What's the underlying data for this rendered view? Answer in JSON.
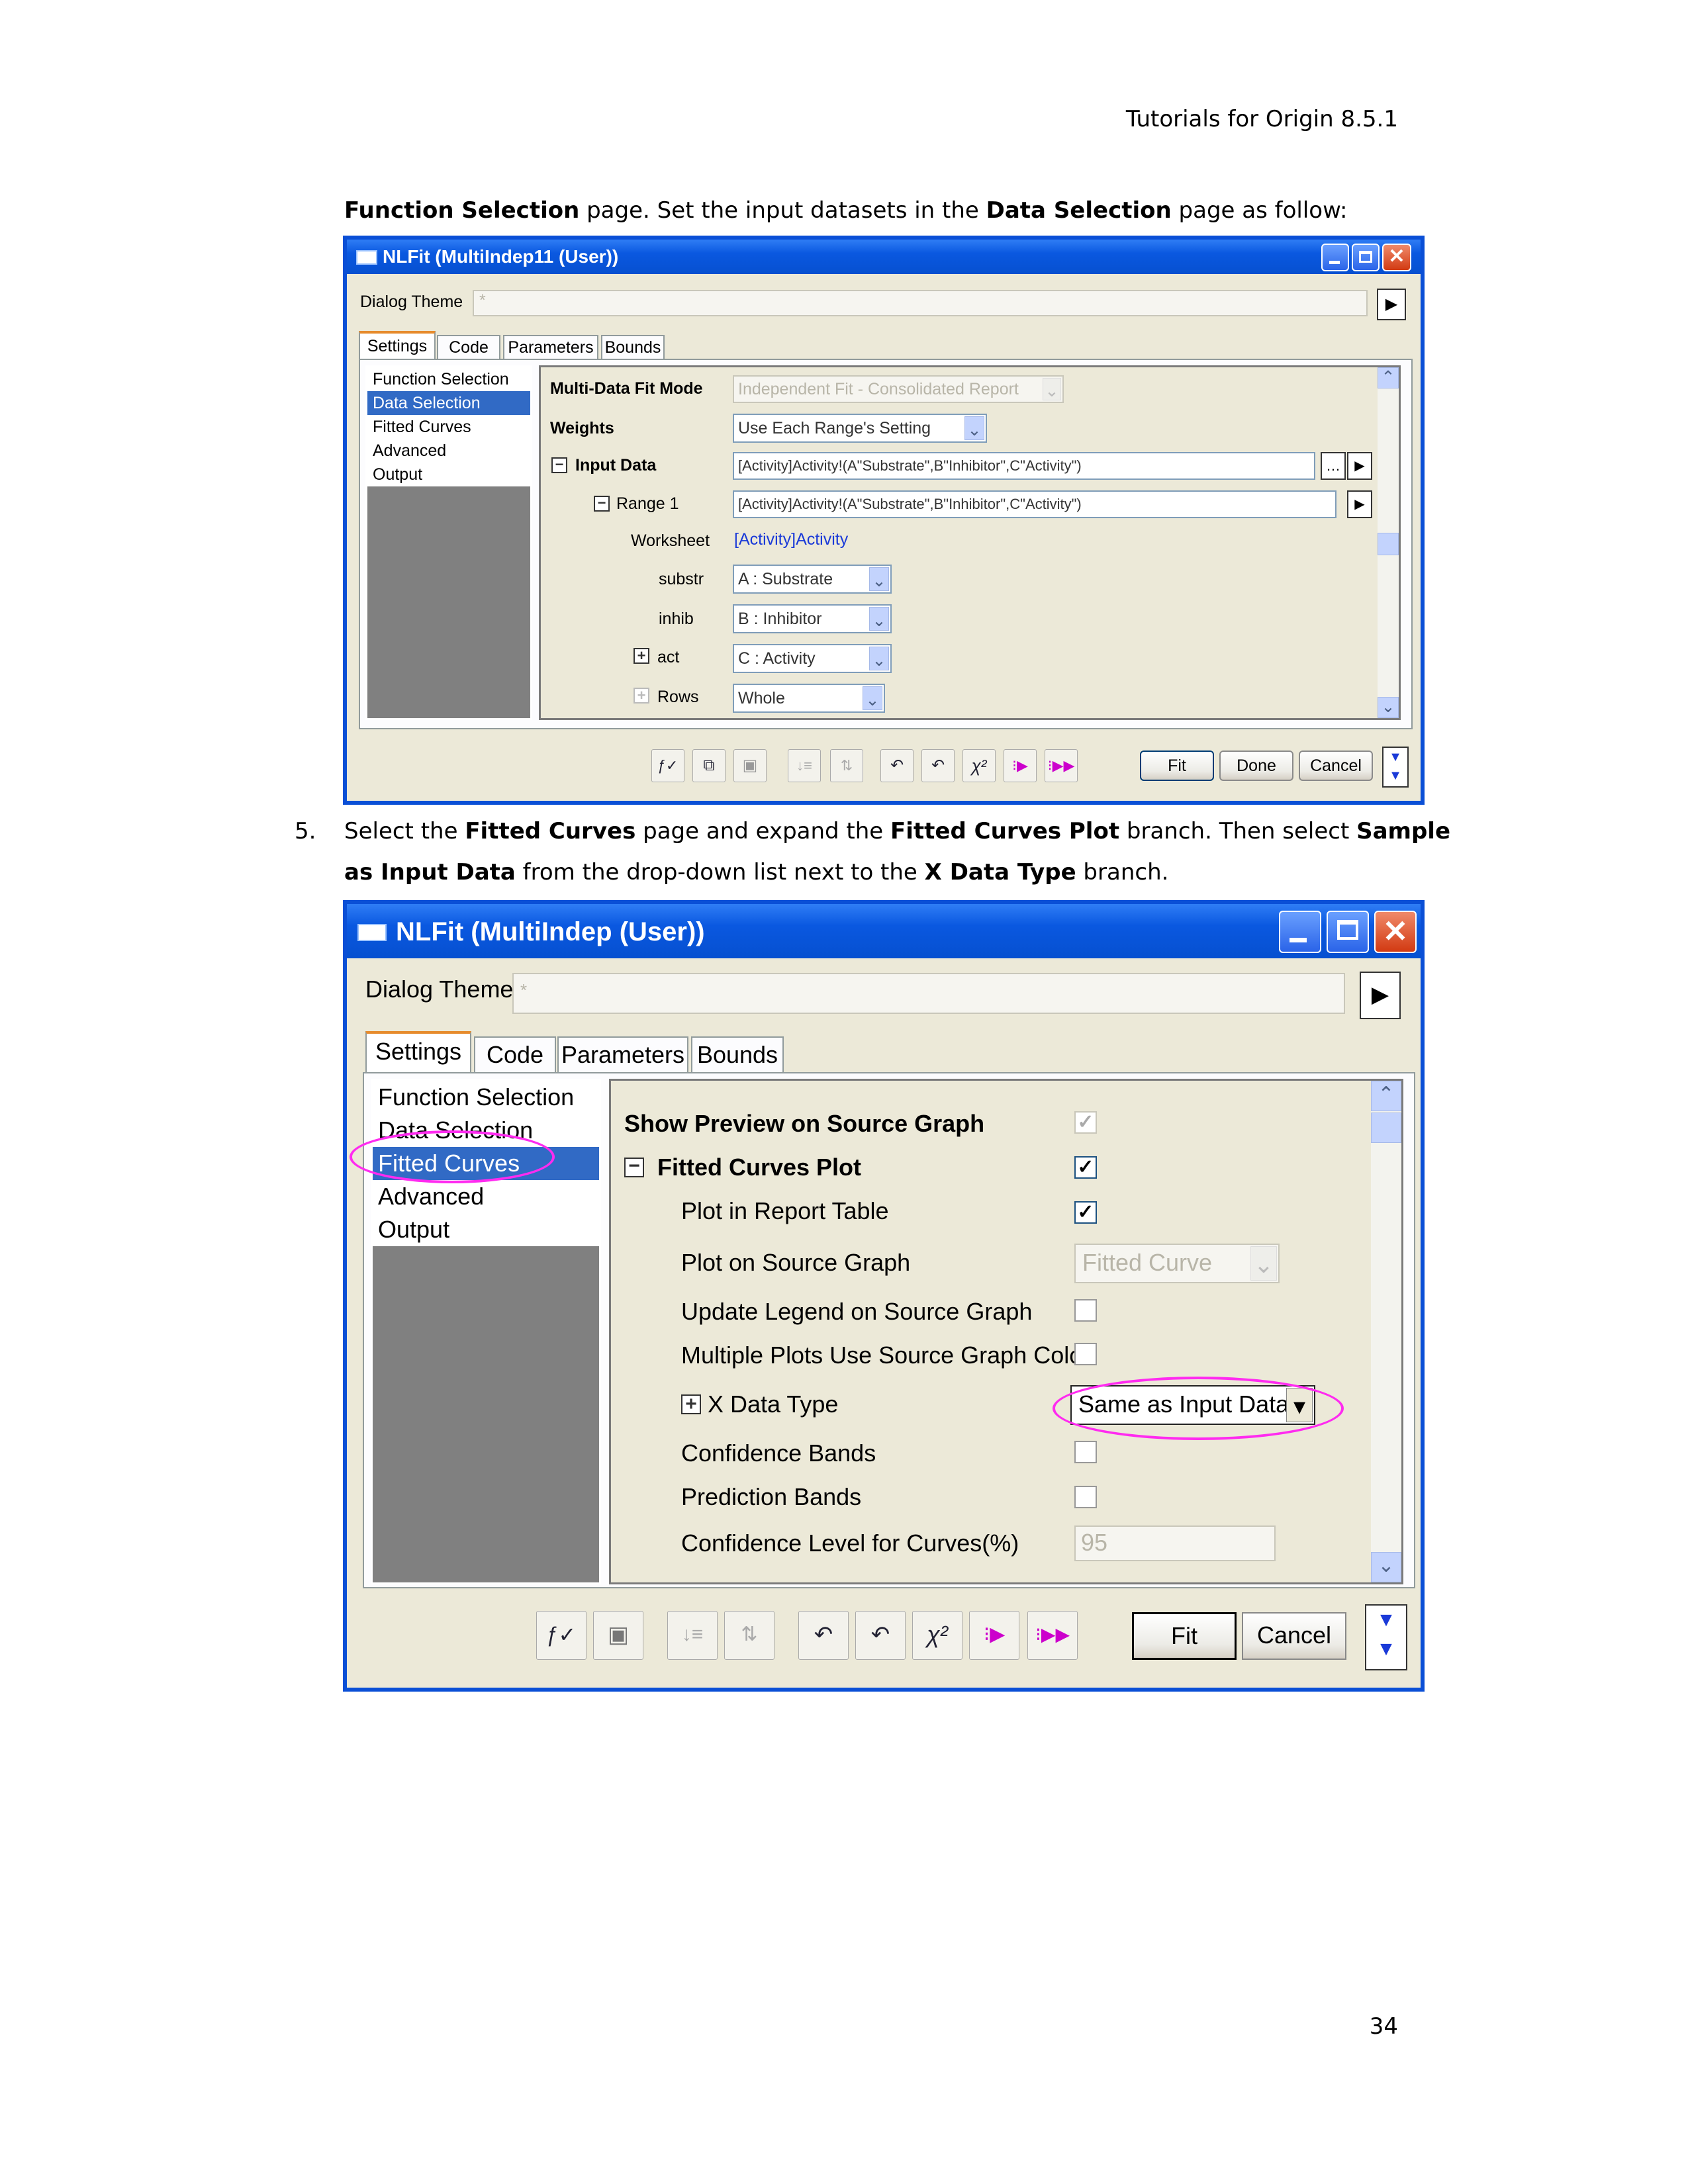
{
  "page": {
    "header": "Tutorials for Origin 8.5.1",
    "page_number": "34",
    "intro": {
      "b1": "Function Selection",
      "t1": " page. Set the input datasets in the ",
      "b2": "Data Selection",
      "t2": " page as follow:"
    },
    "step5": {
      "number": "5.",
      "t1": "Select the ",
      "b1": "Fitted Curves",
      "t2": " page and expand the ",
      "b2": "Fitted Curves Plot",
      "t3": " branch. Then select ",
      "b3": "Sample",
      "b4": "as Input Data",
      "t4": " from the drop-down list next to the ",
      "b5": "X Data Type",
      "t5": " branch."
    }
  },
  "dialog1": {
    "title": "NLFit (MultiIndep11 (User))",
    "theme_label": "Dialog Theme",
    "theme_value": "*",
    "tabs": [
      "Settings",
      "Code",
      "Parameters",
      "Bounds"
    ],
    "nav": [
      "Function Selection",
      "Data Selection",
      "Fitted Curves",
      "Advanced",
      "Output"
    ],
    "rows": {
      "fit_mode_label": "Multi-Data Fit Mode",
      "fit_mode_value": "Independent Fit - Consolidated Report",
      "weights_label": "Weights",
      "weights_value": "Use Each Range's Setting",
      "input_label": "Input Data",
      "input_value": "[Activity]Activity!(A\"Substrate\",B\"Inhibitor\",C\"Activity\")",
      "range_label": "Range 1",
      "range_value": "[Activity]Activity!(A\"Substrate\",B\"Inhibitor\",C\"Activity\")",
      "worksheet_label": "Worksheet",
      "worksheet_value": "[Activity]Activity",
      "substr_label": "substr",
      "substr_value": "A : Substrate",
      "inhib_label": "inhib",
      "inhib_value": "B : Inhibitor",
      "act_label": "act",
      "act_value": "C : Activity",
      "rows_label": "Rows",
      "rows_value": "Whole"
    },
    "buttons": {
      "fit": "Fit",
      "done": "Done",
      "cancel": "Cancel"
    }
  },
  "dialog2": {
    "title": "NLFit (MultiIndep (User))",
    "theme_label": "Dialog Theme",
    "theme_value": "*",
    "tabs": [
      "Settings",
      "Code",
      "Parameters",
      "Bounds"
    ],
    "nav": [
      "Function Selection",
      "Data Selection",
      "Fitted Curves",
      "Advanced",
      "Output"
    ],
    "rows": {
      "preview_label": "Show Preview on Source Graph",
      "fcp_label": "Fitted Curves Plot",
      "report_label": "Plot in Report Table",
      "source_label": "Plot on Source Graph",
      "source_value": "Fitted Curve",
      "legend_label": "Update Legend on Source Graph",
      "color_label": "Multiple Plots Use Source Graph Color",
      "xtype_label": "X Data Type",
      "xtype_value": "Same as Input Data",
      "conf_label": "Confidence Bands",
      "pred_label": "Prediction Bands",
      "level_label": "Confidence Level for Curves(%)",
      "level_value": "95"
    },
    "buttons": {
      "fit": "Fit",
      "cancel": "Cancel"
    },
    "highlight_color": "#ff2bf0"
  }
}
